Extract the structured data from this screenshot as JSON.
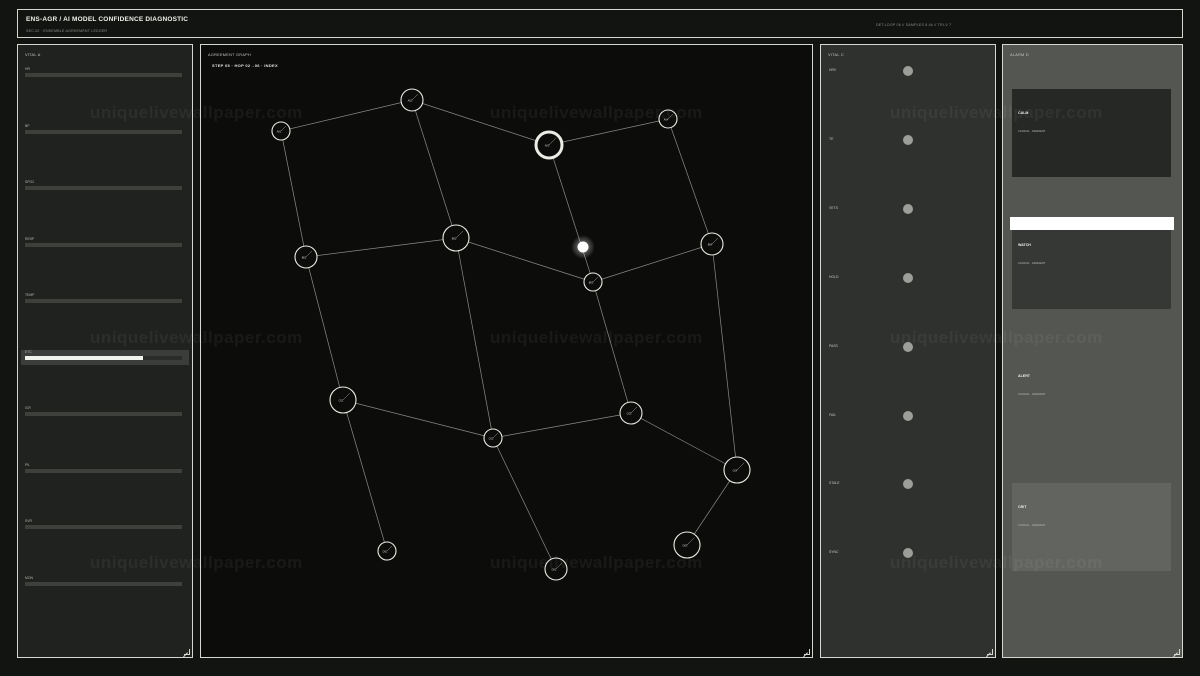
{
  "header": {
    "title": "ENS-AGR  /  AI MODEL CONFIDENCE DIAGNOSTIC",
    "subtitle": "SEC.02 · ENSEMBLE AGREEMENT LEDGER",
    "status": "DET.LOOP 06 // SAMPLES 8.4k // TRI-V 7"
  },
  "vital_a": {
    "title": "VITAL A",
    "rows": [
      {
        "label": "HR",
        "fill": 0
      },
      {
        "label": "BP",
        "fill": 0
      },
      {
        "label": "SPO2",
        "fill": 0
      },
      {
        "label": "RESP",
        "fill": 0
      },
      {
        "label": "TEMP",
        "fill": 0
      },
      {
        "label": "ETC",
        "fill": 0.75,
        "highlight": true
      },
      {
        "label": "ICR",
        "fill": 0
      },
      {
        "label": "PIL",
        "fill": 0
      },
      {
        "label": "SVR",
        "fill": 0
      },
      {
        "label": "MON",
        "fill": 0
      }
    ]
  },
  "graph": {
    "title": "AGREEMENT GRAPH",
    "subtitle": "STEP 05 · HOP 02→06 · INDEX",
    "nodes": [
      {
        "label": "A01"
      },
      {
        "label": "A02"
      },
      {
        "label": "A03"
      },
      {
        "label": "A04"
      },
      {
        "label": "B01"
      },
      {
        "label": "B02"
      },
      {
        "label": "B03"
      },
      {
        "label": "B04"
      },
      {
        "label": "C01"
      },
      {
        "label": "C02"
      },
      {
        "label": "C03"
      },
      {
        "label": "C04"
      },
      {
        "label": "D01"
      },
      {
        "label": "D02"
      },
      {
        "label": "D03"
      }
    ]
  },
  "vital_c": {
    "title": "VITAL C",
    "rows": [
      {
        "label": "HRV"
      },
      {
        "label": "TE"
      },
      {
        "label": "VETS"
      },
      {
        "label": "HOLD"
      },
      {
        "label": "PASS"
      },
      {
        "label": "FAIL"
      },
      {
        "label": "STALE"
      },
      {
        "label": "SYNC"
      }
    ]
  },
  "alarm": {
    "title": "ALARM D",
    "cards": [
      {
        "name": "CALM",
        "note": "CLINICAL · GRADIENT",
        "color": "#262825"
      },
      {
        "name": "WATCH",
        "note": "CLINICAL · GRADIENT",
        "color": "#363835"
      },
      {
        "name": "ALERT",
        "note": "CLINICAL · GRADIENT",
        "color": "#545651"
      },
      {
        "name": "CRIT",
        "note": "CLINICAL · GRADIENT",
        "color": "#626460"
      }
    ]
  },
  "watermark": "uniquelivewallpaper.com"
}
